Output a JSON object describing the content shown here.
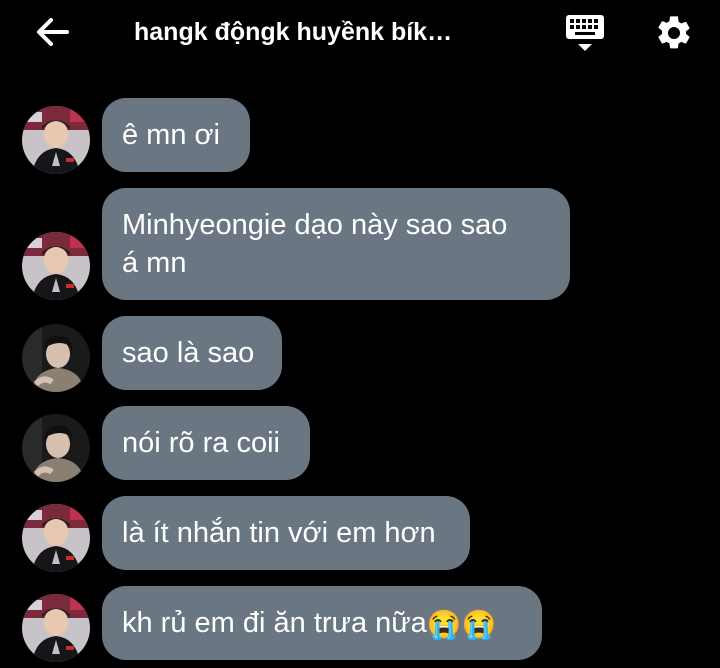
{
  "header": {
    "title": "hangk độngk huyềnk bík…",
    "back_icon": "arrow-left-icon",
    "keyboard_icon": "keyboard-icon",
    "settings_icon": "gear-icon"
  },
  "messages": [
    {
      "avatar": "avatar-1",
      "text": "ê mn ơi"
    },
    {
      "avatar": "avatar-1",
      "text": "Minhyeongie dạo này sao sao",
      "text2": "á mn"
    },
    {
      "avatar": "avatar-2",
      "text": "sao là sao"
    },
    {
      "avatar": "avatar-2",
      "text": "nói rõ ra coii"
    },
    {
      "avatar": "avatar-1",
      "text": "là ít nhắn tin với em hơn"
    },
    {
      "avatar": "avatar-1",
      "text": "kh rủ em đi ăn trưa nữa",
      "emoji": "😭😭"
    }
  ],
  "colors": {
    "background": "#000000",
    "bubble": "#6a7782",
    "text": "#ffffff"
  }
}
